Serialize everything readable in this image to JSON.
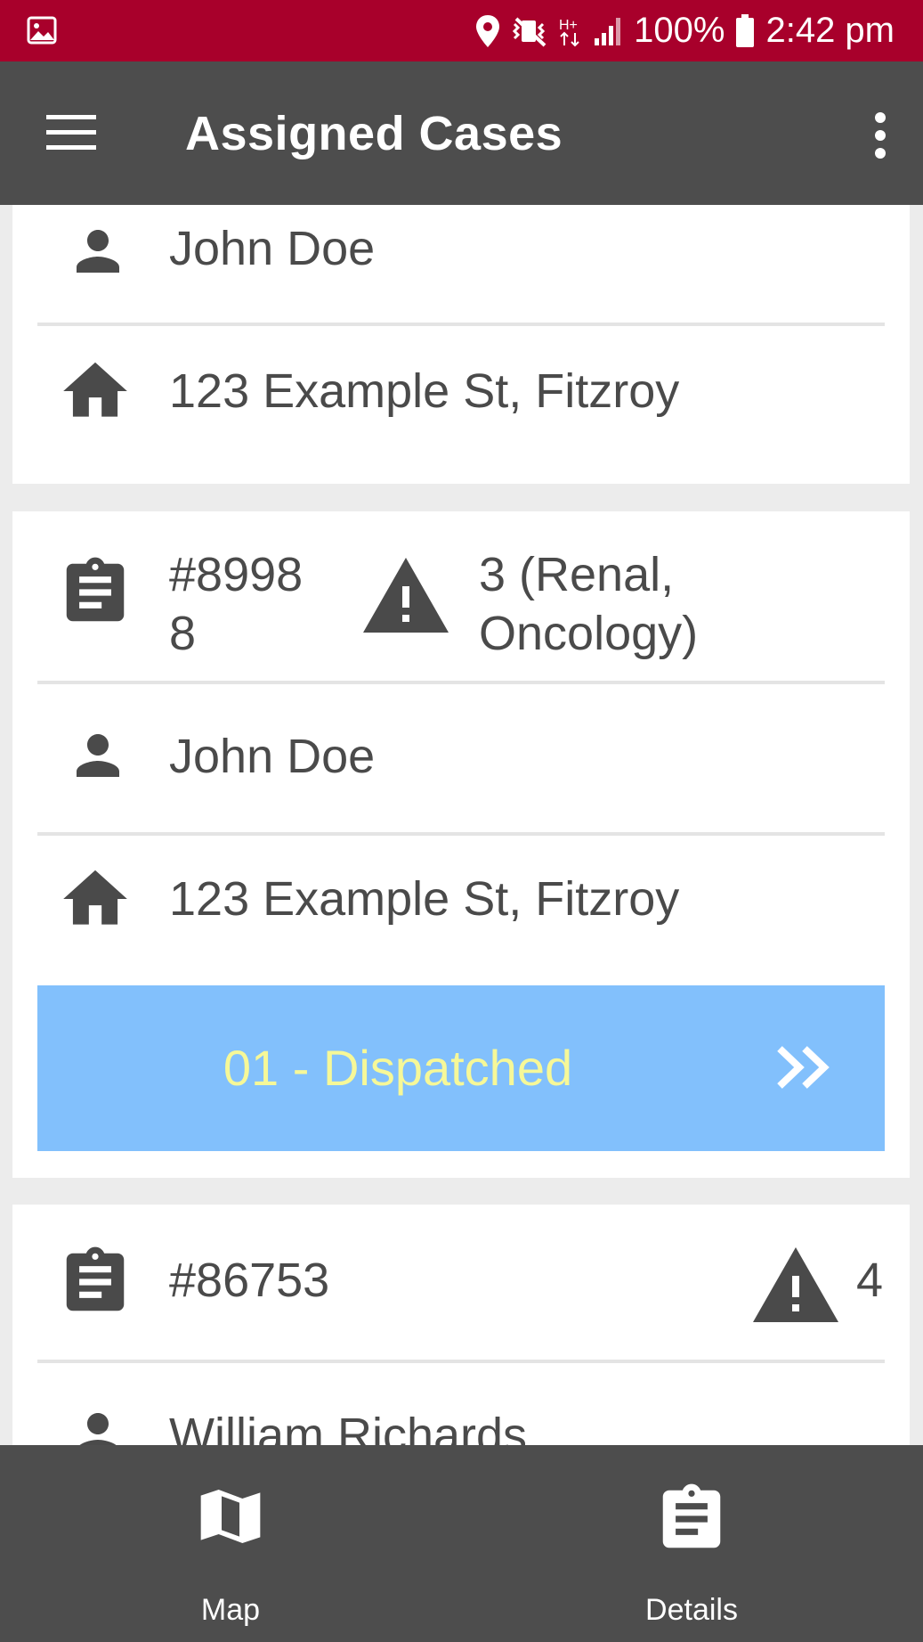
{
  "status_bar": {
    "battery": "100%",
    "time": "2:42 pm"
  },
  "app_bar": {
    "title": "Assigned Cases"
  },
  "cases": [
    {
      "name": "John Doe",
      "address": "123 Example St, Fitzroy"
    },
    {
      "case_number_line1": "#8998",
      "case_number_line2": "8",
      "alert_line1": "3 (Renal,",
      "alert_line2": "Oncology)",
      "name": "John Doe",
      "address": "123 Example St, Fitzroy",
      "status_button": "01 - Dispatched"
    },
    {
      "case_number": "#86753",
      "alert": "4",
      "name_partial": "William Richards"
    }
  ],
  "bottom_nav": {
    "map_label": "Map",
    "details_label": "Details"
  },
  "colors": {
    "status_bar": "#a8002b",
    "app_bar": "#4d4d4d",
    "dispatch_bg": "#82c0fc",
    "dispatch_text": "#f6f898",
    "icon": "#4a4a4a"
  }
}
